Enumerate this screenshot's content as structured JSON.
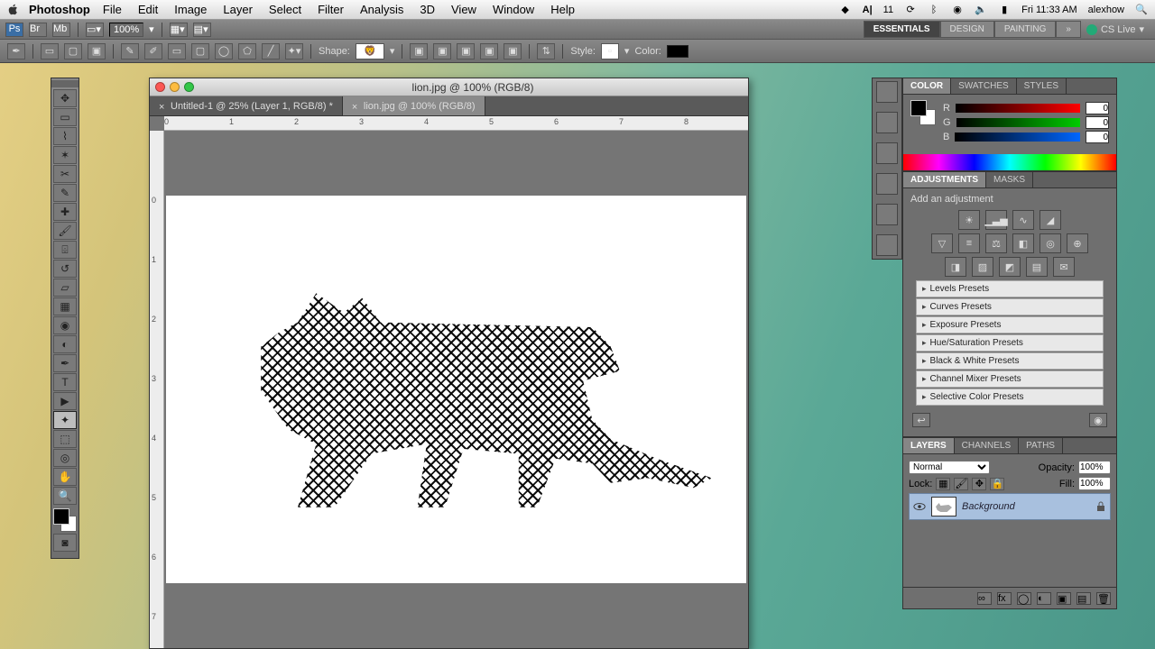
{
  "menubar": {
    "app_name": "Photoshop",
    "items": [
      "File",
      "Edit",
      "Image",
      "Layer",
      "Select",
      "Filter",
      "Analysis",
      "3D",
      "View",
      "Window",
      "Help"
    ],
    "right": {
      "adobe_num": "11",
      "clock": "Fri 11:33 AM",
      "user": "alexhow"
    }
  },
  "options_bar": {
    "zoom": "100%",
    "workspaces": [
      "ESSENTIALS",
      "DESIGN",
      "PAINTING"
    ],
    "cs_live": "CS Live"
  },
  "tool_options": {
    "shape_label": "Shape:",
    "style_label": "Style:",
    "color_label": "Color:"
  },
  "document": {
    "window_title": "lion.jpg @ 100% (RGB/8)",
    "tabs": [
      {
        "label": "Untitled-1 @ 25% (Layer 1, RGB/8) *"
      },
      {
        "label": "lion.jpg @ 100% (RGB/8)"
      }
    ],
    "hticks": [
      "0",
      "1",
      "2",
      "3",
      "4",
      "5",
      "6",
      "7",
      "8"
    ],
    "vticks": [
      "0",
      "1",
      "2",
      "3",
      "4",
      "5",
      "6",
      "7"
    ]
  },
  "color_panel": {
    "tabs": [
      "COLOR",
      "SWATCHES",
      "STYLES"
    ],
    "r_label": "R",
    "g_label": "G",
    "b_label": "B",
    "r": "0",
    "g": "0",
    "b": "0"
  },
  "adjustments_panel": {
    "tabs": [
      "ADJUSTMENTS",
      "MASKS"
    ],
    "hint": "Add an adjustment",
    "presets": [
      "Levels Presets",
      "Curves Presets",
      "Exposure Presets",
      "Hue/Saturation Presets",
      "Black & White Presets",
      "Channel Mixer Presets",
      "Selective Color Presets"
    ]
  },
  "layers_panel": {
    "tabs": [
      "LAYERS",
      "CHANNELS",
      "PATHS"
    ],
    "blend_mode": "Normal",
    "opacity_label": "Opacity:",
    "opacity": "100%",
    "fill_label": "Fill:",
    "fill": "100%",
    "lock_label": "Lock:",
    "layers": [
      {
        "name": "Background"
      }
    ]
  }
}
